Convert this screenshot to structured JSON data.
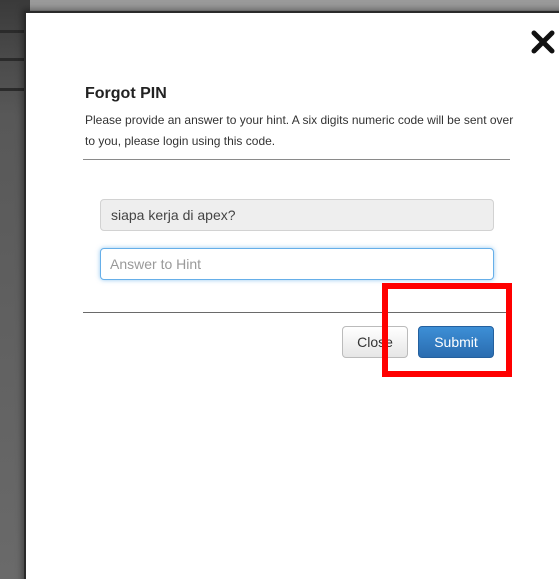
{
  "dialog": {
    "title": "Forgot PIN",
    "description": "Please provide an answer to your hint. A six digits numeric code will be sent over to you, please login using this code.",
    "close_icon": "close-x-icon"
  },
  "form": {
    "hint_question": "siapa kerja di apex?",
    "answer_placeholder": "Answer to Hint",
    "answer_value": ""
  },
  "buttons": {
    "close_label": "Close",
    "submit_label": "Submit"
  },
  "colors": {
    "submit_button": "#2f78c4",
    "highlight_annotation": "#ff0000",
    "input_focus": "#66afe9"
  }
}
